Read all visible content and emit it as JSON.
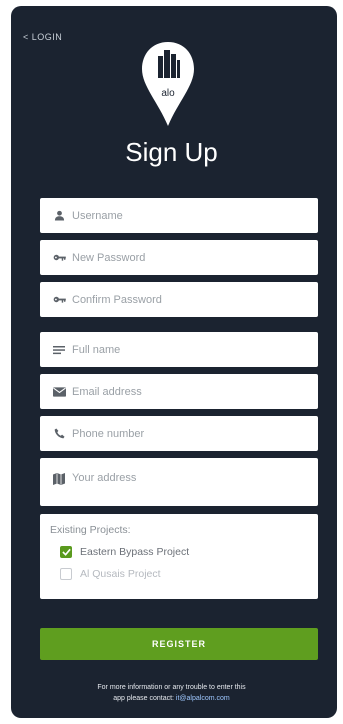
{
  "nav": {
    "back_label": "< LOGIN"
  },
  "brand": {
    "logo_text": "alo"
  },
  "page": {
    "title": "Sign Up"
  },
  "fields": {
    "username": {
      "placeholder": "Username",
      "icon": "user-icon"
    },
    "new_password": {
      "placeholder": "New Password",
      "icon": "key-icon"
    },
    "confirm_password": {
      "placeholder": "Confirm Password",
      "icon": "key-icon"
    },
    "full_name": {
      "placeholder": "Full name",
      "icon": "list-icon"
    },
    "email": {
      "placeholder": "Email address",
      "icon": "envelope-icon"
    },
    "phone": {
      "placeholder": "Phone number",
      "icon": "phone-icon"
    },
    "address": {
      "placeholder": "Your address",
      "icon": "map-icon"
    }
  },
  "projects": {
    "label": "Existing Projects:",
    "items": [
      {
        "label": "Eastern Bypass Project",
        "checked": true
      },
      {
        "label": "Al Qusais Project",
        "checked": false
      }
    ]
  },
  "actions": {
    "register_label": "REGISTER"
  },
  "footer": {
    "line1": "For more information or any trouble to enter this",
    "line2_prefix": "app please contact: ",
    "email": "it@alpalcom.com"
  },
  "colors": {
    "panel_bg": "#1b2330",
    "accent_green": "#5f9e1f",
    "link_blue": "#9fc8ff"
  }
}
